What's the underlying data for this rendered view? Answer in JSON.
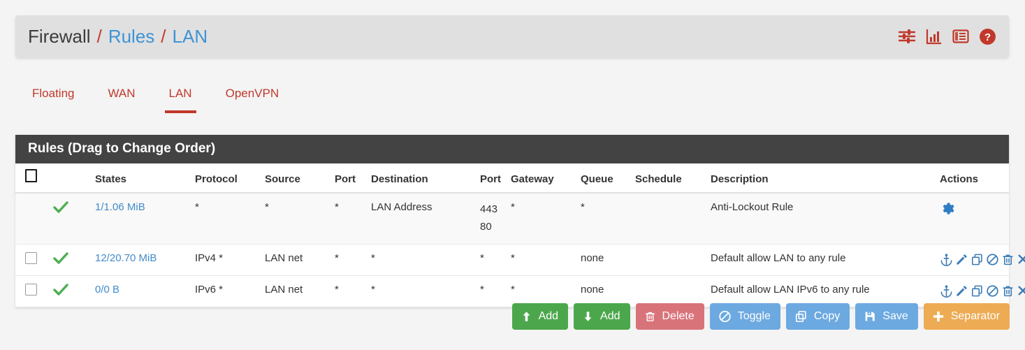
{
  "breadcrumb": {
    "root": "Firewall",
    "sep": "/",
    "level2": "Rules",
    "level3": "LAN"
  },
  "header_icons": [
    {
      "name": "sliders-icon",
      "label": "Advanced Filter"
    },
    {
      "name": "bar-chart-icon",
      "label": "Traffic Graph"
    },
    {
      "name": "log-list-icon",
      "label": "Firewall Log"
    },
    {
      "name": "help-circle-icon",
      "label": "Help"
    }
  ],
  "tabs": [
    {
      "label": "Floating",
      "active": false
    },
    {
      "label": "WAN",
      "active": false
    },
    {
      "label": "LAN",
      "active": true
    },
    {
      "label": "OpenVPN",
      "active": false
    }
  ],
  "panel": {
    "heading": "Rules (Drag to Change Order)"
  },
  "table": {
    "columns": [
      "",
      "",
      "States",
      "Protocol",
      "Source",
      "Port",
      "Destination",
      "Port",
      "Gateway",
      "Queue",
      "Schedule",
      "Description",
      "Actions"
    ],
    "rows": [
      {
        "selectable": false,
        "status": "pass-check",
        "states": "1/1.06 MiB",
        "protocol": "*",
        "source": "*",
        "source_port": "*",
        "destination": "LAN Address",
        "dest_ports": [
          "443",
          "80"
        ],
        "gateway": "*",
        "queue": "*",
        "schedule": "",
        "description": "Anti-Lockout Rule",
        "actions": [
          "gear-icon"
        ]
      },
      {
        "selectable": true,
        "status": "pass-check",
        "states": "12/20.70 MiB",
        "protocol": "IPv4 *",
        "source": "LAN net",
        "source_port": "*",
        "destination": "*",
        "dest_ports": [
          "*"
        ],
        "gateway": "*",
        "queue": "none",
        "schedule": "",
        "description": "Default allow LAN to any rule",
        "actions": [
          "anchor-icon",
          "pencil-icon",
          "copy-icon",
          "ban-icon",
          "trash-icon",
          "close-icon"
        ]
      },
      {
        "selectable": true,
        "status": "pass-check",
        "states": "0/0 B",
        "protocol": "IPv6 *",
        "source": "LAN net",
        "source_port": "*",
        "destination": "*",
        "dest_ports": [
          "*"
        ],
        "gateway": "*",
        "queue": "none",
        "schedule": "",
        "description": "Default allow LAN IPv6 to any rule",
        "actions": [
          "anchor-icon",
          "pencil-icon",
          "copy-icon",
          "ban-icon",
          "trash-icon",
          "close-icon"
        ]
      }
    ]
  },
  "buttons": [
    {
      "label": "Add",
      "icon": "arrow-up-icon",
      "style": "green"
    },
    {
      "label": "Add",
      "icon": "arrow-down-icon",
      "style": "green"
    },
    {
      "label": "Delete",
      "icon": "trash-icon",
      "style": "red"
    },
    {
      "label": "Toggle",
      "icon": "ban-icon",
      "style": "blue"
    },
    {
      "label": "Copy",
      "icon": "copy-icon",
      "style": "blue"
    },
    {
      "label": "Save",
      "icon": "save-icon",
      "style": "blue"
    },
    {
      "label": "Separator",
      "icon": "plus-icon",
      "style": "orange"
    }
  ],
  "colors": {
    "brand_red": "#c0392b",
    "link_blue": "#428bca",
    "icon_blue": "#3c7cb5",
    "check_green": "#4caf50",
    "panel_dark": "#434343",
    "btn_green": "#4ca74c",
    "btn_red": "#d9737a",
    "btn_blue": "#6ca9e0",
    "btn_orange": "#edab54"
  }
}
